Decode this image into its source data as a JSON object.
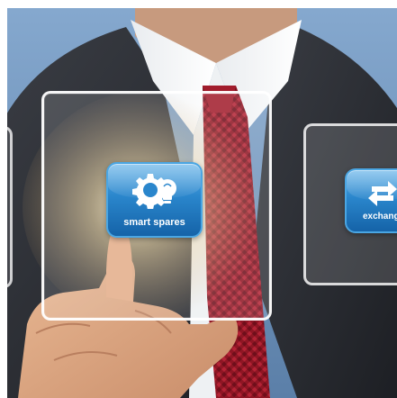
{
  "tiles": {
    "smart_spares": {
      "label": "smart spares",
      "icon": "gear-lightbulb-icon"
    },
    "exchange": {
      "label": "exchang",
      "icon": "exchange-arrows-icon"
    }
  },
  "colors": {
    "tile_blue": "#2a86cc",
    "tile_blue_dark": "#1563a8",
    "tile_blue_light": "#5fb0e8",
    "panel_border": "#ffffff",
    "tie_red": "#9e1b2a",
    "suit_dark": "#2b2d33",
    "sky_blue": "#6e93bd"
  }
}
